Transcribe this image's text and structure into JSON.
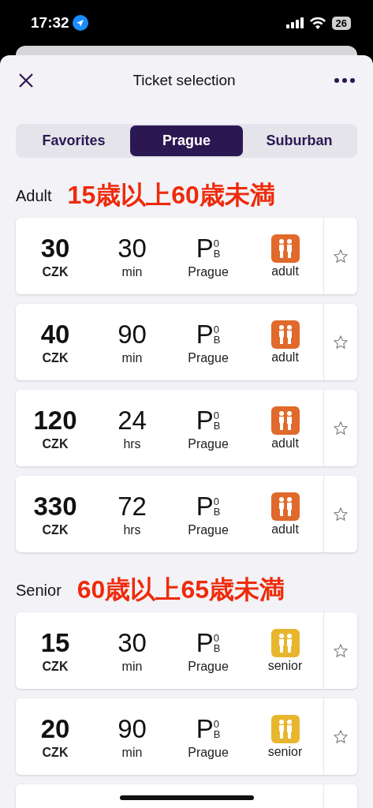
{
  "status_bar": {
    "time": "17:32",
    "battery": "26"
  },
  "header": {
    "title": "Ticket selection"
  },
  "tabs": [
    {
      "label": "Favorites",
      "selected": false
    },
    {
      "label": "Prague",
      "selected": true
    },
    {
      "label": "Suburban",
      "selected": false
    }
  ],
  "sections": [
    {
      "title": "Adult",
      "note": "15歳以上60歳未満",
      "tickets": [
        {
          "kind": "full",
          "price": "30",
          "currency": "CZK",
          "duration": "30",
          "unit": "min",
          "zone": {
            "letter": "P",
            "sup": "0",
            "sub": "B",
            "label": "Prague"
          },
          "fare": "adult",
          "color": "#e0692b",
          "favorite": false
        },
        {
          "kind": "full",
          "price": "40",
          "currency": "CZK",
          "duration": "90",
          "unit": "min",
          "zone": {
            "letter": "P",
            "sup": "0",
            "sub": "B",
            "label": "Prague"
          },
          "fare": "adult",
          "color": "#e0692b",
          "favorite": false
        },
        {
          "kind": "full",
          "price": "120",
          "currency": "CZK",
          "duration": "24",
          "unit": "hrs",
          "zone": {
            "letter": "P",
            "sup": "0",
            "sub": "B",
            "label": "Prague"
          },
          "fare": "adult",
          "color": "#e0692b",
          "favorite": false
        },
        {
          "kind": "full",
          "price": "330",
          "currency": "CZK",
          "duration": "72",
          "unit": "hrs",
          "zone": {
            "letter": "P",
            "sup": "0",
            "sub": "B",
            "label": "Prague"
          },
          "fare": "adult",
          "color": "#e0692b",
          "favorite": false
        }
      ]
    },
    {
      "title": "Senior",
      "note": "60歳以上65歳未満",
      "tickets": [
        {
          "kind": "full",
          "price": "15",
          "currency": "CZK",
          "duration": "30",
          "unit": "min",
          "zone": {
            "letter": "P",
            "sup": "0",
            "sub": "B",
            "label": "Prague"
          },
          "fare": "senior",
          "color": "#e8b62e",
          "favorite": false
        },
        {
          "kind": "full",
          "price": "20",
          "currency": "CZK",
          "duration": "90",
          "unit": "min",
          "zone": {
            "letter": "P",
            "sup": "0",
            "sub": "B",
            "label": "Prague"
          },
          "fare": "senior",
          "color": "#e8b62e",
          "favorite": false
        },
        {
          "kind": "partial"
        }
      ]
    }
  ]
}
